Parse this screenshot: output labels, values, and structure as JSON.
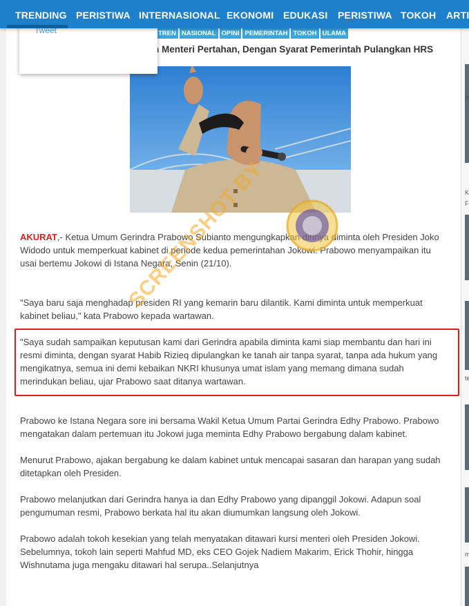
{
  "nav": {
    "items": [
      "TRENDING",
      "PERISTIWA",
      "INTERNASIONAL",
      "EKONOMI",
      "EDUKASI",
      "PERISTIWA",
      "TOKOH",
      "ARTI"
    ]
  },
  "share": {
    "tweet": "Tweet"
  },
  "tags": [
    "TREN",
    "NASIONAL",
    "OPINI",
    "PEMERINTAH",
    "TOKOH",
    "ULAMA"
  ],
  "headline": "h Menteri Pertahan, Dengan Syarat Pemerintah Pulangkan HRS",
  "article": {
    "lead_word": "AKURAT",
    "p1": ",- Ketua Umum Gerindra Prabowo Subianto mengungkapkan dirinya diminta oleh Presiden Joko Widodo untuk memperkuat kabinet di periode kedua pemerintahan Jokowi. Prabowo menyampaikan itu usai bertemu Jokowi di Istana Negara, Senin (21/10).",
    "p2": "\"Saya baru saja menghadap presiden RI yang kemarin baru dilantik. Kami diminta untuk memperkuat kabinet beliau,\" kata Prabowo kepada wartawan.",
    "p3": "\"Saya sudah sampaikan keputusan kami dari Gerindra apabila diminta kami siap membantu dan hari ini resmi diminta, dengan syarat Habib Rizieq dipulangkan ke tanah air tanpa syarat, tanpa ada hukum yang mengikatnya, semua ini demi kebaikan NKRI khusunya umat islam yang memang dimana sudah merindukan beliau, ujar Prabowo saat ditanya wartawan.",
    "p4": "Prabowo ke Istana Negara sore ini bersama Wakil Ketua Umum Partai Gerindra Edhy Prabowo. Prabowo mengatakan dalam pertemuan itu Jokowi juga meminta Edhy Prabowo bergabung dalam kabinet.",
    "p5": "Menurut Prabowo, ajakan bergabung ke dalam kabinet untuk mencapai sasaran dan harapan yang sudah ditetapkan oleh Presiden.",
    "p6": "Prabowo melanjutkan dari Gerindra hanya ia dan Edhy Prabowo yang dipanggil Jokowi. Adapun soal pengumuman resmi, Prabowo berkata hal itu akan diumumkan langsung oleh Jokowi.",
    "p7": "Prabowo adalah tokoh kesekian yang telah menyatakan ditawari kursi menteri oleh Presiden Jokowi. Sebelumnya, tokoh lain seperti Mahfud MD, eks CEO Gojek Nadiem Makarim, Erick Thohir, hingga Wishnutama juga mengaku ditawari hal serupa..Selanjutnya"
  },
  "watermark": "SCREENSHOT BY",
  "sidebar_chars": [
    "P",
    "K",
    "F",
    "te",
    "m"
  ],
  "colors": {
    "nav": "#1e7fcb",
    "highlight": "#e3171c",
    "lead": "#e31b23",
    "tag": "#3aa6e0"
  }
}
